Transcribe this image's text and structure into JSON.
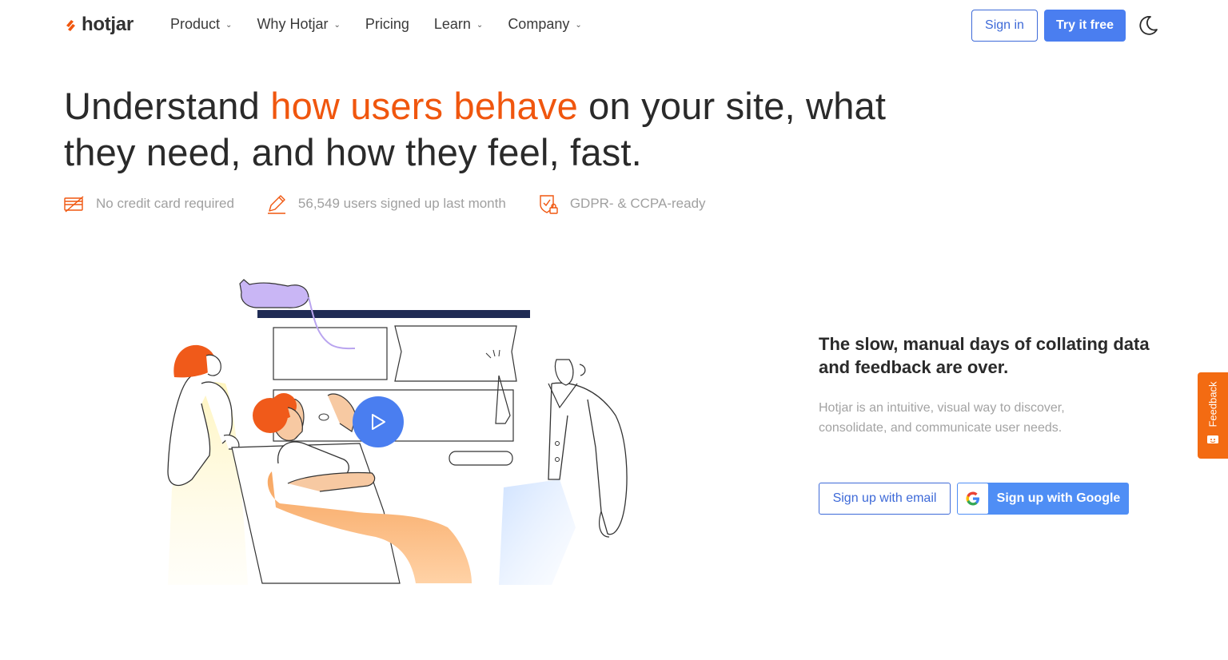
{
  "header": {
    "logo_text": "hotjar",
    "nav": [
      {
        "label": "Product",
        "has_dropdown": true
      },
      {
        "label": "Why Hotjar",
        "has_dropdown": true
      },
      {
        "label": "Pricing",
        "has_dropdown": false
      },
      {
        "label": "Learn",
        "has_dropdown": true
      },
      {
        "label": "Company",
        "has_dropdown": true
      }
    ],
    "sign_in_label": "Sign in",
    "try_free_label": "Try it free",
    "theme_icon": "moon-icon"
  },
  "hero": {
    "headline_pre": "Understand ",
    "headline_accent": "how users behave",
    "headline_post": " on your site, what they need, and how they feel, fast.",
    "badges": [
      {
        "icon": "credit-card-icon",
        "text": "No credit card required"
      },
      {
        "icon": "pencil-icon",
        "text": "56,549 users signed up last month"
      },
      {
        "icon": "shield-lock-icon",
        "text": "GDPR- & CCPA-ready"
      }
    ]
  },
  "side": {
    "subheading": "The slow, manual days of collating data and feedback are over.",
    "description": "Hotjar is an intuitive, visual way to discover, consolidate, and communicate user needs.",
    "signup_email_label": "Sign up with email",
    "signup_google_label": "Sign up with Google"
  },
  "feedback_tab": {
    "label": "Feedback"
  },
  "colors": {
    "accent_orange": "#f0560e",
    "primary_blue": "#4a7ef0",
    "feedback_orange": "#f36b12"
  }
}
